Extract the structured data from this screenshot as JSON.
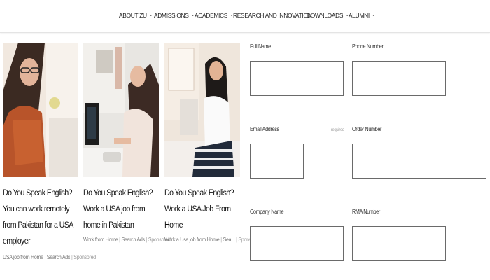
{
  "nav": {
    "items": [
      {
        "label": "ABOUT ZU"
      },
      {
        "label": "ADMISSIONS"
      },
      {
        "label": "ACADEMICS"
      },
      {
        "label": "RESEARCH AND INNOVATION"
      },
      {
        "label": "DOWNLOADS"
      },
      {
        "label": "ALUMNI"
      }
    ]
  },
  "cards": [
    {
      "title": "Do You Speak English? You can work remotely from Pakistan for a USA employer",
      "source": "USA job from Home",
      "category": "Search Ads",
      "sponsored": "Sponsored"
    },
    {
      "title": "Do You Speak English? Work a USA job from home in Pakistan",
      "source": "Work from Home",
      "category": "Search Ads",
      "sponsored": "Sponsored"
    },
    {
      "title": "Do You Speak English? Work a USA Job From Home",
      "source": "Work a Usa job from Home",
      "category": "Sea...",
      "sponsored": "Sponsored"
    }
  ],
  "form": {
    "full_name": {
      "label": "Full Name",
      "value": ""
    },
    "phone_number": {
      "label": "Phone Number",
      "value": ""
    },
    "email_address": {
      "label": "Email Address",
      "hint": "required",
      "value": ""
    },
    "order_number": {
      "label": "Order Number",
      "value": ""
    },
    "company_name": {
      "label": "Company Name",
      "value": ""
    },
    "rma_number": {
      "label": "RMA Number",
      "value": ""
    }
  }
}
